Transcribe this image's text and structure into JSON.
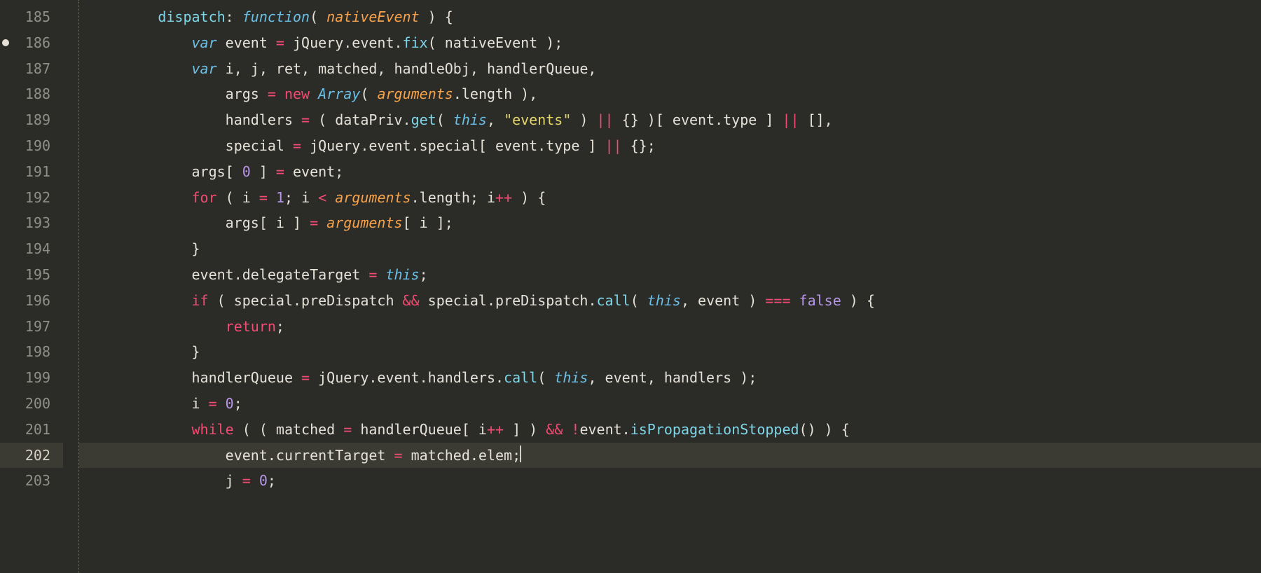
{
  "gutter": {
    "start": 185,
    "end": 203,
    "modified_line": 186,
    "current_line": 202
  },
  "code": {
    "lines": [
      [
        {
          "c": "tok-key",
          "t": "dispatch"
        },
        {
          "c": "tok-punc",
          "t": ": "
        },
        {
          "c": "tok-storage",
          "t": "function"
        },
        {
          "c": "tok-punc",
          "t": "( "
        },
        {
          "c": "tok-param",
          "t": "nativeEvent"
        },
        {
          "c": "tok-punc",
          "t": " ) "
        },
        {
          "c": "tok-brace",
          "t": "{"
        }
      ],
      [
        {
          "c": "tok-punc",
          "t": "    "
        },
        {
          "c": "tok-var",
          "t": "var"
        },
        {
          "c": "tok-punc",
          "t": " event "
        },
        {
          "c": "tok-op",
          "t": "="
        },
        {
          "c": "tok-punc",
          "t": " jQuery.event."
        },
        {
          "c": "tok-call",
          "t": "fix"
        },
        {
          "c": "tok-punc",
          "t": "( nativeEvent );"
        }
      ],
      [
        {
          "c": "tok-punc",
          "t": "    "
        },
        {
          "c": "tok-var",
          "t": "var"
        },
        {
          "c": "tok-punc",
          "t": " i, j, ret, matched, handleObj, handlerQueue,"
        }
      ],
      [
        {
          "c": "tok-punc",
          "t": "        args "
        },
        {
          "c": "tok-op",
          "t": "="
        },
        {
          "c": "tok-punc",
          "t": " "
        },
        {
          "c": "tok-new",
          "t": "new"
        },
        {
          "c": "tok-punc",
          "t": " "
        },
        {
          "c": "tok-class",
          "t": "Array"
        },
        {
          "c": "tok-punc",
          "t": "( "
        },
        {
          "c": "tok-param",
          "t": "arguments"
        },
        {
          "c": "tok-punc",
          "t": ".length ),"
        }
      ],
      [
        {
          "c": "tok-punc",
          "t": "        handlers "
        },
        {
          "c": "tok-op",
          "t": "="
        },
        {
          "c": "tok-punc",
          "t": " ( dataPriv."
        },
        {
          "c": "tok-call",
          "t": "get"
        },
        {
          "c": "tok-punc",
          "t": "( "
        },
        {
          "c": "tok-class",
          "t": "this"
        },
        {
          "c": "tok-punc",
          "t": ", "
        },
        {
          "c": "tok-string",
          "t": "\"events\""
        },
        {
          "c": "tok-punc",
          "t": " ) "
        },
        {
          "c": "tok-op",
          "t": "||"
        },
        {
          "c": "tok-punc",
          "t": " {} )[ event.type ] "
        },
        {
          "c": "tok-op",
          "t": "||"
        },
        {
          "c": "tok-punc",
          "t": " [],"
        }
      ],
      [
        {
          "c": "tok-punc",
          "t": "        special "
        },
        {
          "c": "tok-op",
          "t": "="
        },
        {
          "c": "tok-punc",
          "t": " jQuery.event.special[ event.type ] "
        },
        {
          "c": "tok-op",
          "t": "||"
        },
        {
          "c": "tok-punc",
          "t": " {};"
        }
      ],
      [
        {
          "c": "tok-punc",
          "t": "    args[ "
        },
        {
          "c": "tok-number",
          "t": "0"
        },
        {
          "c": "tok-punc",
          "t": " ] "
        },
        {
          "c": "tok-op",
          "t": "="
        },
        {
          "c": "tok-punc",
          "t": " event;"
        }
      ],
      [
        {
          "c": "tok-punc",
          "t": "    "
        },
        {
          "c": "tok-new",
          "t": "for"
        },
        {
          "c": "tok-punc",
          "t": " ( i "
        },
        {
          "c": "tok-op",
          "t": "="
        },
        {
          "c": "tok-punc",
          "t": " "
        },
        {
          "c": "tok-number",
          "t": "1"
        },
        {
          "c": "tok-punc",
          "t": "; i "
        },
        {
          "c": "tok-op",
          "t": "<"
        },
        {
          "c": "tok-punc",
          "t": " "
        },
        {
          "c": "tok-param",
          "t": "arguments"
        },
        {
          "c": "tok-punc",
          "t": ".length; i"
        },
        {
          "c": "tok-op",
          "t": "++"
        },
        {
          "c": "tok-punc",
          "t": " ) "
        },
        {
          "c": "tok-brace",
          "t": "{"
        }
      ],
      [
        {
          "c": "tok-punc",
          "t": "        args[ i ] "
        },
        {
          "c": "tok-op",
          "t": "="
        },
        {
          "c": "tok-punc",
          "t": " "
        },
        {
          "c": "tok-param",
          "t": "arguments"
        },
        {
          "c": "tok-punc",
          "t": "[ i ];"
        }
      ],
      [
        {
          "c": "tok-punc",
          "t": "    "
        },
        {
          "c": "tok-brace",
          "t": "}"
        }
      ],
      [
        {
          "c": "tok-punc",
          "t": "    event.delegateTarget "
        },
        {
          "c": "tok-op",
          "t": "="
        },
        {
          "c": "tok-punc",
          "t": " "
        },
        {
          "c": "tok-class",
          "t": "this"
        },
        {
          "c": "tok-punc",
          "t": ";"
        }
      ],
      [
        {
          "c": "tok-punc",
          "t": "    "
        },
        {
          "c": "tok-new",
          "t": "if"
        },
        {
          "c": "tok-punc",
          "t": " ( special.preDispatch "
        },
        {
          "c": "tok-op",
          "t": "&&"
        },
        {
          "c": "tok-punc",
          "t": " special.preDispatch."
        },
        {
          "c": "tok-call",
          "t": "call"
        },
        {
          "c": "tok-punc",
          "t": "( "
        },
        {
          "c": "tok-class",
          "t": "this"
        },
        {
          "c": "tok-punc",
          "t": ", event ) "
        },
        {
          "c": "tok-op",
          "t": "==="
        },
        {
          "c": "tok-punc",
          "t": " "
        },
        {
          "c": "tok-const",
          "t": "false"
        },
        {
          "c": "tok-punc",
          "t": " ) "
        },
        {
          "c": "tok-brace",
          "t": "{"
        }
      ],
      [
        {
          "c": "tok-punc",
          "t": "        "
        },
        {
          "c": "tok-new",
          "t": "return"
        },
        {
          "c": "tok-punc",
          "t": ";"
        }
      ],
      [
        {
          "c": "tok-punc",
          "t": "    "
        },
        {
          "c": "tok-brace",
          "t": "}"
        }
      ],
      [
        {
          "c": "tok-punc",
          "t": "    handlerQueue "
        },
        {
          "c": "tok-op",
          "t": "="
        },
        {
          "c": "tok-punc",
          "t": " jQuery.event.handlers."
        },
        {
          "c": "tok-call",
          "t": "call"
        },
        {
          "c": "tok-punc",
          "t": "( "
        },
        {
          "c": "tok-class",
          "t": "this"
        },
        {
          "c": "tok-punc",
          "t": ", event, handlers );"
        }
      ],
      [
        {
          "c": "tok-punc",
          "t": "    i "
        },
        {
          "c": "tok-op",
          "t": "="
        },
        {
          "c": "tok-punc",
          "t": " "
        },
        {
          "c": "tok-number",
          "t": "0"
        },
        {
          "c": "tok-punc",
          "t": ";"
        }
      ],
      [
        {
          "c": "tok-punc",
          "t": "    "
        },
        {
          "c": "tok-new",
          "t": "while"
        },
        {
          "c": "tok-punc",
          "t": " ( ( matched "
        },
        {
          "c": "tok-op",
          "t": "="
        },
        {
          "c": "tok-punc",
          "t": " handlerQueue[ i"
        },
        {
          "c": "tok-op",
          "t": "++"
        },
        {
          "c": "tok-punc",
          "t": " ] ) "
        },
        {
          "c": "tok-op",
          "t": "&&"
        },
        {
          "c": "tok-punc",
          "t": " "
        },
        {
          "c": "tok-op",
          "t": "!"
        },
        {
          "c": "tok-punc",
          "t": "event."
        },
        {
          "c": "tok-call",
          "t": "isPropagationStopped"
        },
        {
          "c": "tok-punc",
          "t": "() ) "
        },
        {
          "c": "tok-brace",
          "t": "{"
        }
      ],
      [
        {
          "c": "tok-punc",
          "t": "        event.currentTarget "
        },
        {
          "c": "tok-op",
          "t": "="
        },
        {
          "c": "tok-punc",
          "t": " matched.elem;"
        },
        {
          "c": "cursor",
          "t": ""
        }
      ],
      [
        {
          "c": "tok-punc",
          "t": "        j "
        },
        {
          "c": "tok-op",
          "t": "="
        },
        {
          "c": "tok-punc",
          "t": " "
        },
        {
          "c": "tok-number",
          "t": "0"
        },
        {
          "c": "tok-punc",
          "t": ";"
        }
      ]
    ]
  }
}
